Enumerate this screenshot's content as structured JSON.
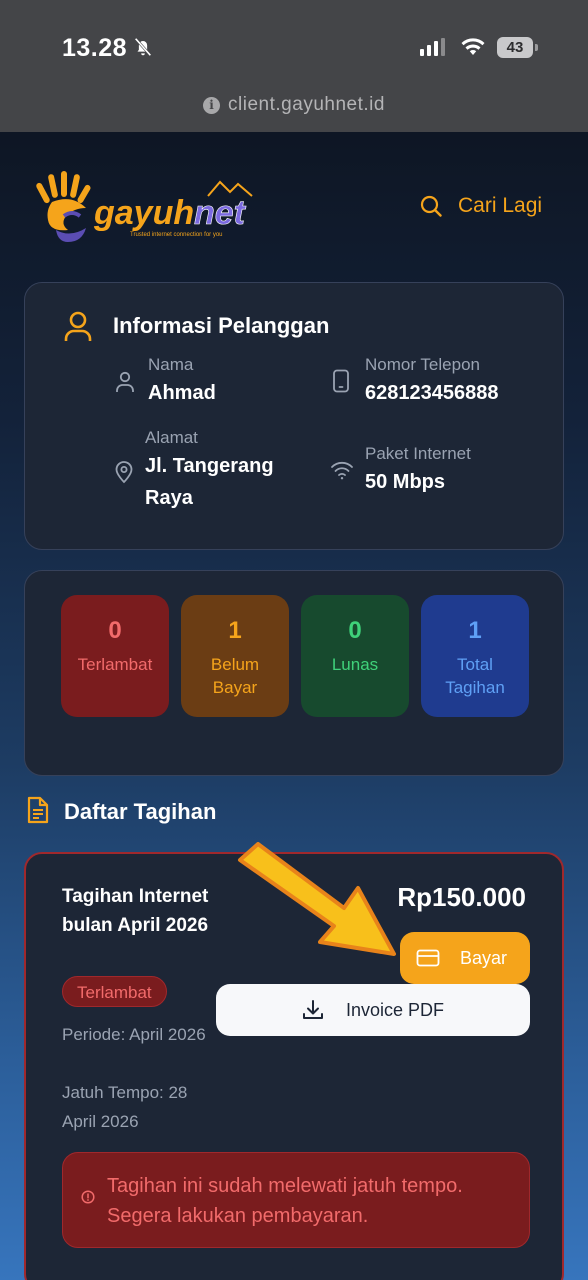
{
  "status_bar": {
    "time": "13.28",
    "battery": "43"
  },
  "browser": {
    "url": "client.gayuhnet.id"
  },
  "header": {
    "logo_text": "gayuhnet",
    "logo_tagline": "Trusted internet connection for you",
    "search_label": "Cari Lagi"
  },
  "customer_info": {
    "title": "Informasi Pelanggan",
    "name_label": "Nama",
    "name_value": "Ahmad",
    "phone_label": "Nomor Telepon",
    "phone_value": "628123456888",
    "address_label": "Alamat",
    "address_line1": "Jl. Tangerang",
    "address_line2": "Raya",
    "package_label": "Paket Internet",
    "package_value": "50 Mbps"
  },
  "stats": [
    {
      "count": "0",
      "line1": "Terlambat",
      "line2": ""
    },
    {
      "count": "1",
      "line1": "Belum",
      "line2": "Bayar"
    },
    {
      "count": "0",
      "line1": "Lunas",
      "line2": ""
    },
    {
      "count": "1",
      "line1": "Total",
      "line2": "Tagihan"
    }
  ],
  "bills_section": {
    "title": "Daftar Tagihan"
  },
  "bill": {
    "title": "Tagihan Internet bulan April 2026",
    "status": "Terlambat",
    "period": "Periode: April 2026",
    "due": "Jatuh Tempo: 28 April 2026",
    "amount": "Rp150.000",
    "pay_label": "Bayar",
    "invoice_label": "Invoice PDF",
    "alert_text": "Tagihan ini sudah melewati jatuh tempo. Segera lakukan pembayaran."
  },
  "colors": {
    "accent": "#f5a41b",
    "late": "#f26b6b",
    "paid": "#3fd17a",
    "total": "#5fa0f5"
  }
}
